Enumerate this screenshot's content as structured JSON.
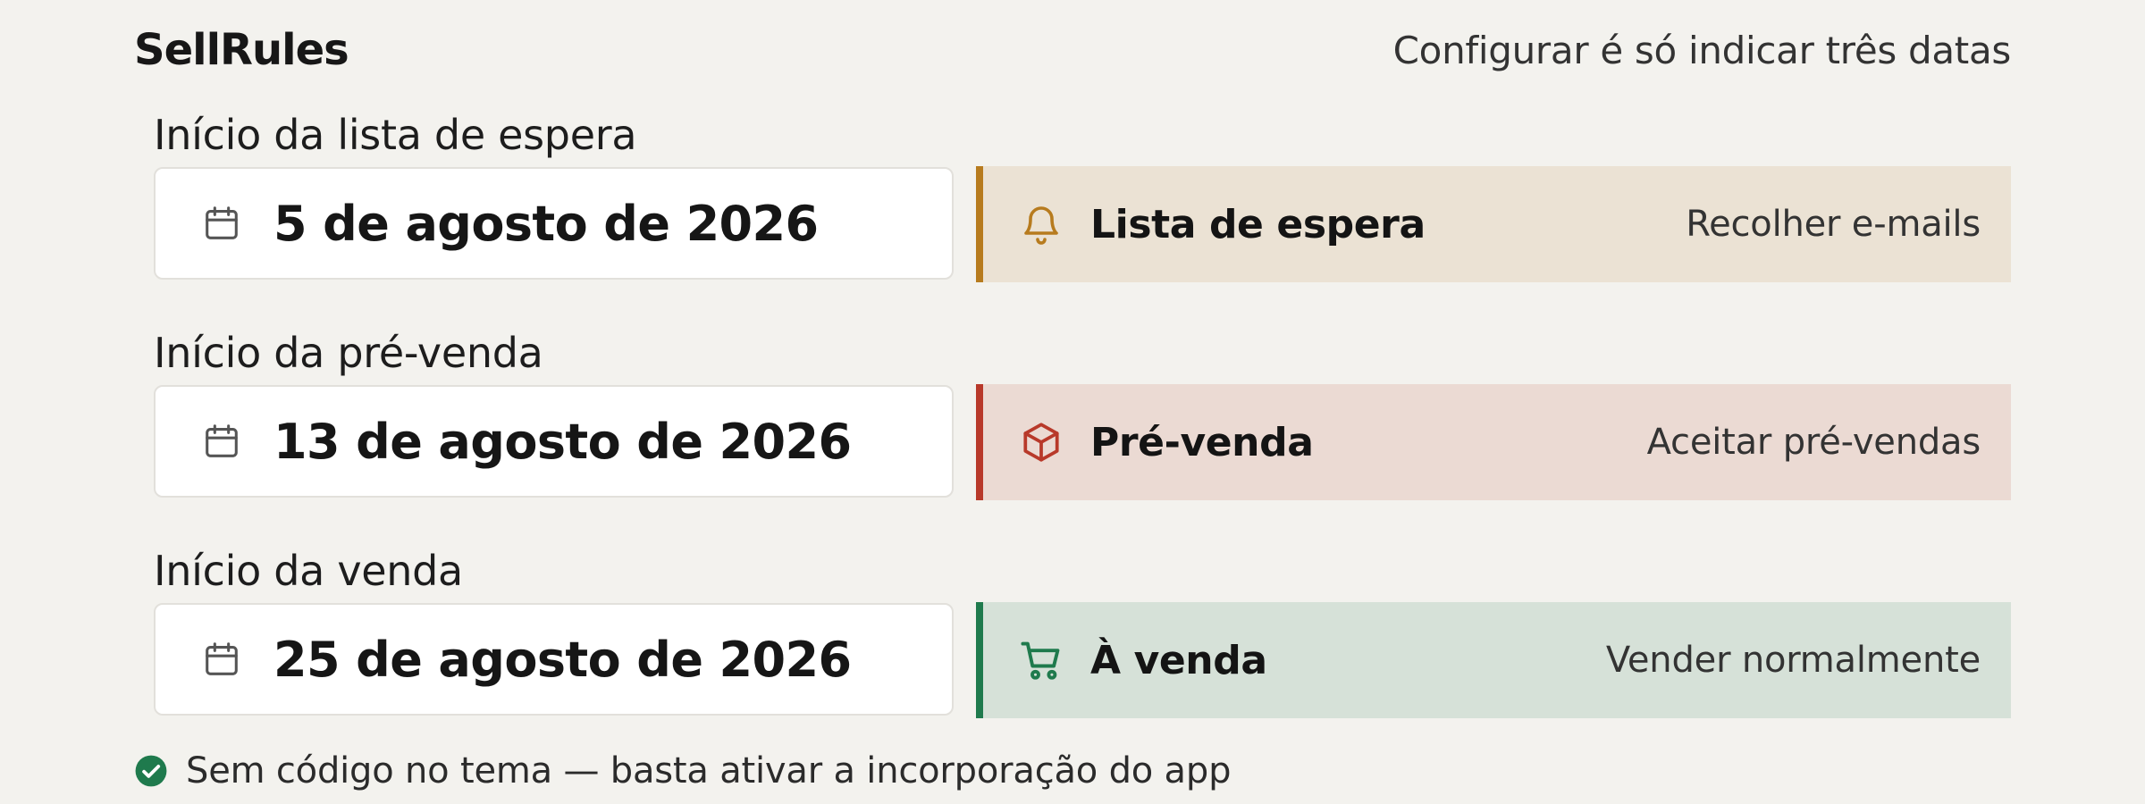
{
  "header": {
    "brand": "SellRules",
    "tagline": "Configurar é só indicar três datas"
  },
  "rows": [
    {
      "label": "Início da lista de espera",
      "date": "5 de agosto de 2026",
      "date_icon": "calendar-icon",
      "status_title": "Lista de espera",
      "status_action": "Recolher e-mails",
      "status_icon": "bell-icon",
      "accent": "#b77b1e",
      "background": "#ebe2d4"
    },
    {
      "label": "Início da pré-venda",
      "date": "13 de agosto de 2026",
      "date_icon": "calendar-icon",
      "status_title": "Pré-venda",
      "status_action": "Aceitar pré-vendas",
      "status_icon": "box-icon",
      "accent": "#b8392a",
      "background": "#ebdad3"
    },
    {
      "label": "Início da venda",
      "date": "25 de agosto de 2026",
      "date_icon": "calendar-icon",
      "status_title": "À venda",
      "status_action": "Vender normalmente",
      "status_icon": "cart-icon",
      "accent": "#1f7a4d",
      "background": "#d6e1d8"
    }
  ],
  "footer": {
    "text": "Sem código no tema — basta ativar a incorporação do app",
    "icon": "check-circle-icon",
    "icon_color": "#1f7a4d"
  }
}
